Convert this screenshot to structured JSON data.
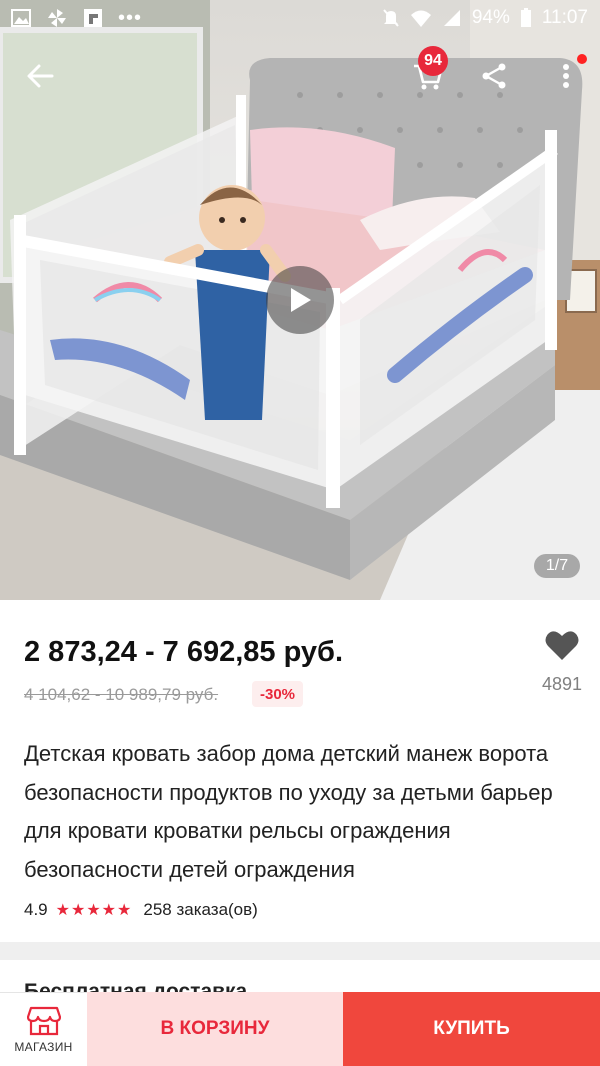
{
  "status_bar": {
    "battery": "94%",
    "time": "11:07"
  },
  "header": {
    "cart_count": "94"
  },
  "gallery": {
    "counter": "1/7"
  },
  "product": {
    "price": "2 873,24 - 7 692,85 руб.",
    "old_price": "4 104,62 - 10 989,79 руб.",
    "discount": "-30%",
    "wishlist_count": "4891",
    "title": "Детская кровать забор дома детский манеж ворота безопасности продуктов по уходу за детьми барьер для кровати кроватки рельсы ограждения безопасности детей ограждения",
    "rating": "4.9",
    "orders": "258 заказа(ов)"
  },
  "shipping": {
    "label": "Бесплатная доставка"
  },
  "bottom_bar": {
    "store_label": "МАГАЗИН",
    "add_to_cart_label": "В КОРЗИНУ",
    "buy_label": "КУПИТЬ"
  },
  "colors": {
    "accent": "#e8283b",
    "buy_button": "#f0473d",
    "cart_button_bg": "#fddede"
  }
}
